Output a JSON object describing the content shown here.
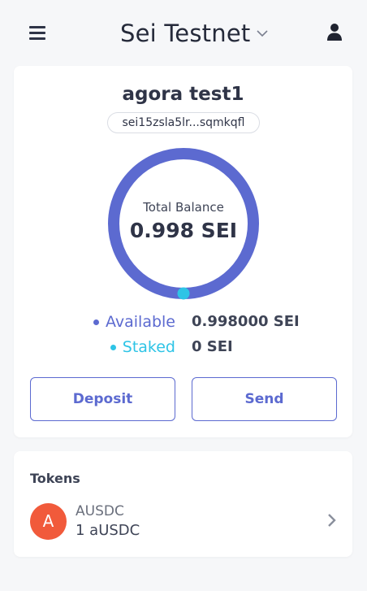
{
  "header": {
    "menu_icon": "hamburger-menu-icon",
    "network": "Sei Testnet",
    "network_chevron_icon": "chevron-down-icon",
    "user_icon": "user-icon"
  },
  "account": {
    "name": "agora test1",
    "address": "sei15zsla5lr...sqmkqfl",
    "total_label": "Total Balance",
    "total_value": "0.998 SEI",
    "ring": {
      "available_fraction": 1.0,
      "staked_fraction": 0.0
    },
    "balances": [
      {
        "label": "Available",
        "value": "0.998000 SEI",
        "color": "#5c6ad0"
      },
      {
        "label": "Staked",
        "value": "0 SEI",
        "color": "#2ec4e6"
      }
    ],
    "actions": {
      "deposit": "Deposit",
      "send": "Send"
    }
  },
  "tokens": {
    "title": "Tokens",
    "items": [
      {
        "avatar": "A",
        "name": "AUSDC",
        "amount": "1 aUSDC",
        "avatar_color": "#f15a3b",
        "chevron_icon": "chevron-right-icon"
      }
    ]
  },
  "colors": {
    "ring_primary": "#5c6ad0",
    "ring_accent": "#2ec4e6",
    "background": "#f6f7f9"
  }
}
